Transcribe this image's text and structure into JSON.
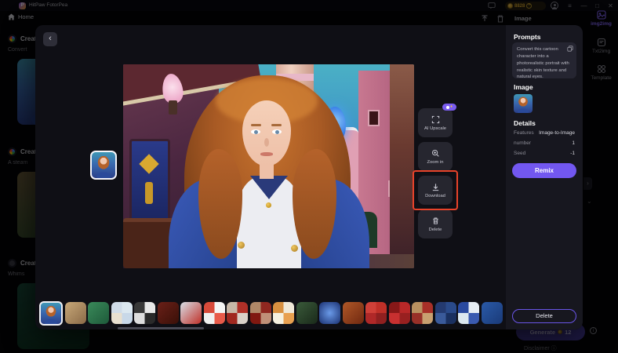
{
  "colors": {
    "accent_purple": "#7257f0",
    "annotation_red": "#e8432a",
    "credits_gold": "#d8a830",
    "selected_border": "#ffffff",
    "sidebar_active": "#8a6cff"
  },
  "titlebar": {
    "app_name": "HitPaw FotorPea",
    "credits": "8828",
    "minimize": "—",
    "maximize": "□",
    "close": "✕"
  },
  "nav": {
    "home_label": "Home",
    "panel_title": "Image"
  },
  "sidebar": {
    "items": [
      {
        "label": "img2img"
      },
      {
        "label": "Txt2img"
      },
      {
        "label": "Template"
      }
    ]
  },
  "history": {
    "items": [
      {
        "title": "Creation",
        "desc": "Convert",
        "thumb": "girl"
      },
      {
        "title": "Creation",
        "desc": "A steam",
        "thumb": "#6a5a3a,#2a4a2a"
      },
      {
        "title": "Creation",
        "desc": "Whims",
        "thumb": "#1a4a3a,#0a2a1a"
      }
    ]
  },
  "generate": {
    "label": "Generate",
    "cost": "12",
    "disclaimer": "Disclaimer"
  },
  "modal": {
    "back_glyph": "‹",
    "main_image_alt": "Photorealistic young girl with long wavy red hair, blue eyes and navy jacket with gold buttons in a colorful whimsical street",
    "actions": [
      {
        "label": "AI Upscale",
        "pro": true
      },
      {
        "label": "Zoom in"
      },
      {
        "label": "Download",
        "highlighted": true
      },
      {
        "label": "Delete"
      }
    ],
    "panel": {
      "prompts_title": "Prompts",
      "prompt_text": "Convert this cartoon character into a photorealistic portrait with realistic skin texture and natural eyes.",
      "image_title": "Image",
      "details_title": "Details",
      "details": [
        {
          "key": "Features",
          "value": "Image-to-Image"
        },
        {
          "key": "number",
          "value": "1"
        },
        {
          "key": "Seed",
          "value": "-1"
        }
      ],
      "remix_label": "Remix",
      "delete_label": "Delete"
    },
    "thumbnails": [
      {
        "type": "girl",
        "selected": true
      },
      {
        "type": "duo",
        "colors": [
          "#c8a878",
          "#8a6a48"
        ]
      },
      {
        "type": "duo",
        "colors": [
          "#3a8a5a",
          "#1e5a3a"
        ]
      },
      {
        "type": "grid4",
        "colors": [
          "#dce8f0",
          "#c8d8e8",
          "#e8e0d0",
          "#d0dce8"
        ]
      },
      {
        "type": "grid4",
        "colors": [
          "#e8e8e8",
          "#2a2a2a",
          "#dddddd",
          "#383838"
        ]
      },
      {
        "type": "duo",
        "colors": [
          "#6a2018",
          "#3a1008"
        ]
      },
      {
        "type": "duo",
        "colors": [
          "#d8e0e8",
          "#c03028"
        ]
      },
      {
        "type": "grid4",
        "colors": [
          "#f5f5f5",
          "#e85a4a",
          "#f0f0f0",
          "#d84a3a"
        ]
      },
      {
        "type": "grid4",
        "colors": [
          "#b03028",
          "#d8d0c8",
          "#a02820",
          "#c8b8a8"
        ]
      },
      {
        "type": "grid4",
        "colors": [
          "#902820",
          "#c09078",
          "#801810",
          "#b08868"
        ]
      },
      {
        "type": "grid4",
        "colors": [
          "#f0e8d8",
          "#e8a050",
          "#f5f0e0",
          "#d89040"
        ]
      },
      {
        "type": "duo",
        "colors": [
          "#3a5a3a",
          "#1a2a1a"
        ]
      },
      {
        "type": "radial",
        "colors": [
          "#6a9ae8",
          "#1a3070"
        ]
      },
      {
        "type": "duo",
        "colors": [
          "#b05828",
          "#702810"
        ]
      },
      {
        "type": "grid4",
        "colors": [
          "#c03028",
          "#902020",
          "#b02828",
          "#d04038"
        ]
      },
      {
        "type": "grid4",
        "colors": [
          "#b82828",
          "#982020",
          "#c83030",
          "#881818"
        ]
      },
      {
        "type": "grid4",
        "colors": [
          "#a83028",
          "#c8a070",
          "#983028",
          "#b89060"
        ]
      },
      {
        "type": "grid4",
        "colors": [
          "#2a4a8a",
          "#1a3060",
          "#3a5a9a",
          "#243a70"
        ]
      },
      {
        "type": "grid4",
        "colors": [
          "#e8eef5",
          "#3a5ab0",
          "#dce8f0",
          "#2a4aa0"
        ]
      },
      {
        "type": "duo",
        "colors": [
          "#2a5aa8",
          "#1a3a78"
        ]
      }
    ]
  }
}
